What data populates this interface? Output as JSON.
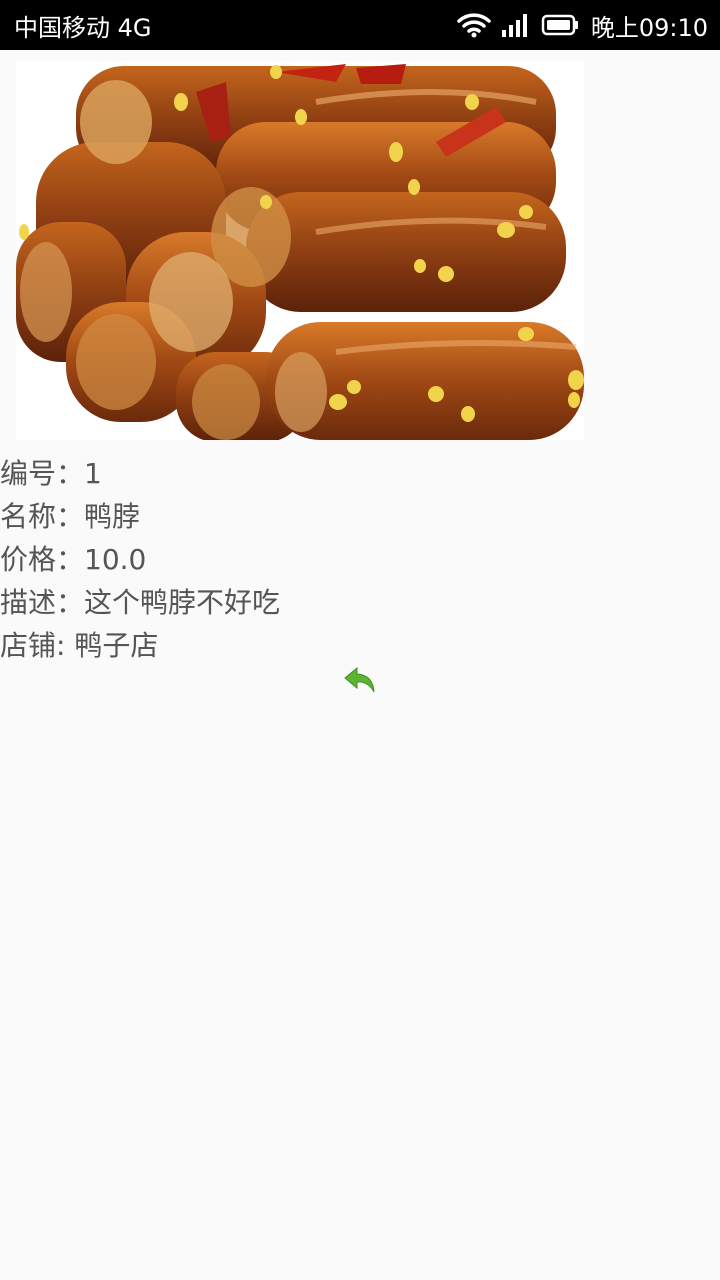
{
  "status_bar": {
    "carrier": "中国移动 4G",
    "time": "晚上09:10",
    "icons": [
      "wifi-icon",
      "signal-icon",
      "battery-icon"
    ]
  },
  "product": {
    "image_icon": "duck-neck-photo",
    "id_line": "编号：1",
    "name_line": "名称：鸭脖",
    "price_line": "价格：10.0",
    "description_line": "描述：这个鸭脖不好吃",
    "shop_line": "店铺: 鸭子店"
  },
  "actions": {
    "back_icon": "back-arrow-icon",
    "accent_color": "#5cb532"
  }
}
